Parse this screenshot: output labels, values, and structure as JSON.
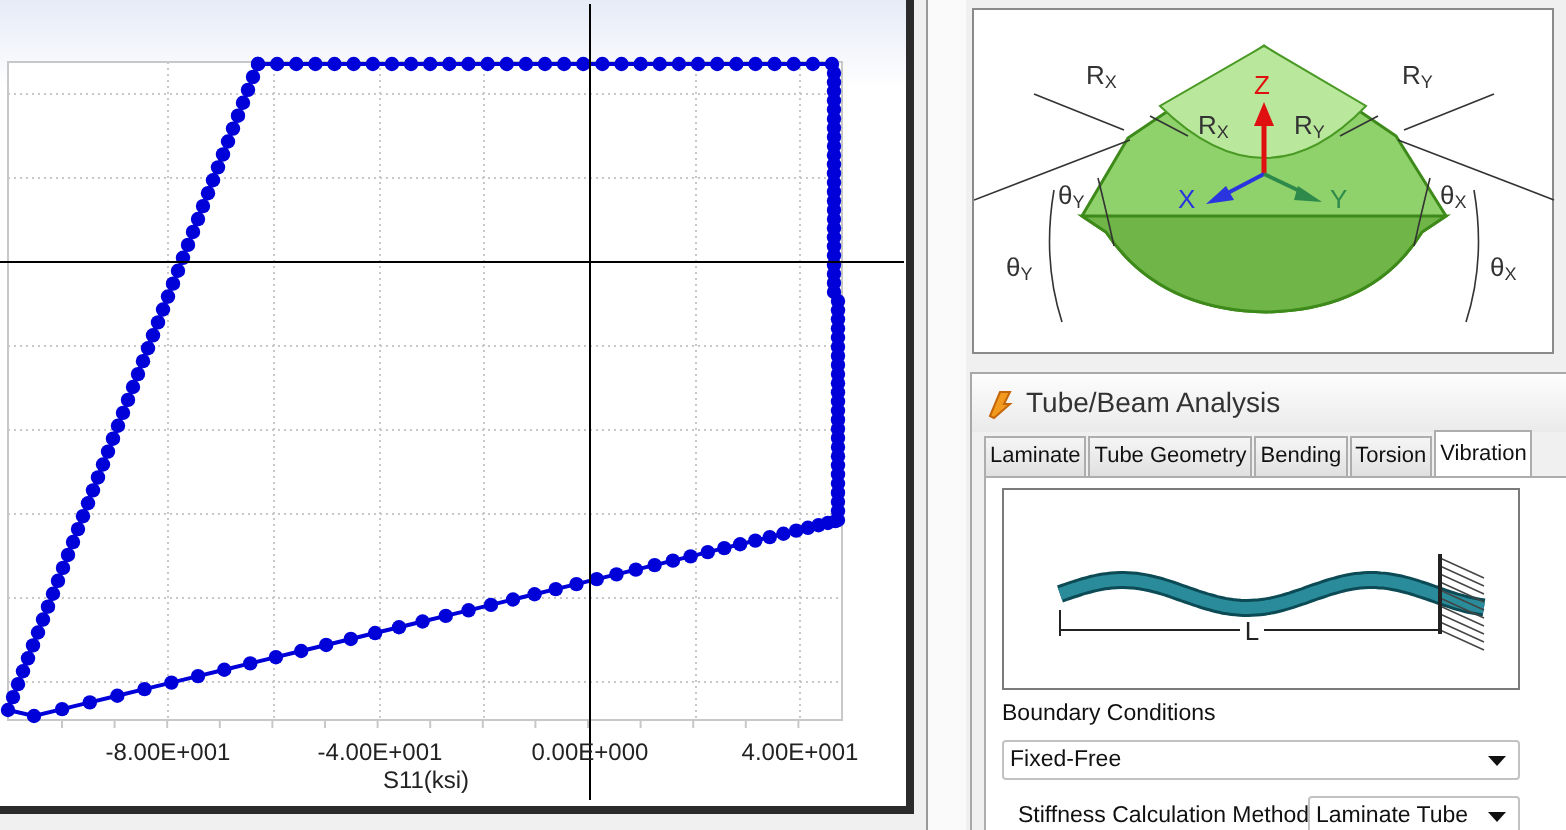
{
  "chart": {
    "xtick_labels": [
      "-8.00E+001",
      "-4.00E+001",
      "0.00E+000",
      "4.00E+001"
    ],
    "xlabel": "S11(ksi)"
  },
  "diagram": {
    "labels": [
      {
        "text": "R$_{X}$",
        "color": "#333333"
      },
      {
        "text": "Z",
        "color": "#e01010"
      },
      {
        "text": "R$_{Y}$",
        "color": "#333333"
      },
      {
        "text": "R$_{X}$",
        "color": "#333333"
      },
      {
        "text": "R$_{Y}$",
        "color": "#333333"
      },
      {
        "text": "θ$_{Y}$",
        "color": "#333333"
      },
      {
        "text": "X",
        "color": "#2a35e0"
      },
      {
        "text": "Y",
        "color": "#2e8a4a"
      },
      {
        "text": "θ$_{X}$",
        "color": "#333333"
      },
      {
        "text": "θ$_{Y}$",
        "color": "#333333"
      },
      {
        "text": "θ$_{X}$",
        "color": "#333333"
      }
    ]
  },
  "dialog": {
    "title": "Tube/Beam Analysis",
    "tabs": [
      {
        "label": "Laminate",
        "selected": false
      },
      {
        "label": "Tube Geometry",
        "selected": false
      },
      {
        "label": "Bending",
        "selected": false
      },
      {
        "label": "Torsion",
        "selected": false
      },
      {
        "label": "Vibration",
        "selected": true
      }
    ],
    "beam_label": "L",
    "boundary_conditions": {
      "label": "Boundary Conditions",
      "value": "Fixed-Free"
    },
    "stiffness_method": {
      "label": "Stiffness Calculation Method",
      "value": "Laminate Tube"
    }
  }
}
